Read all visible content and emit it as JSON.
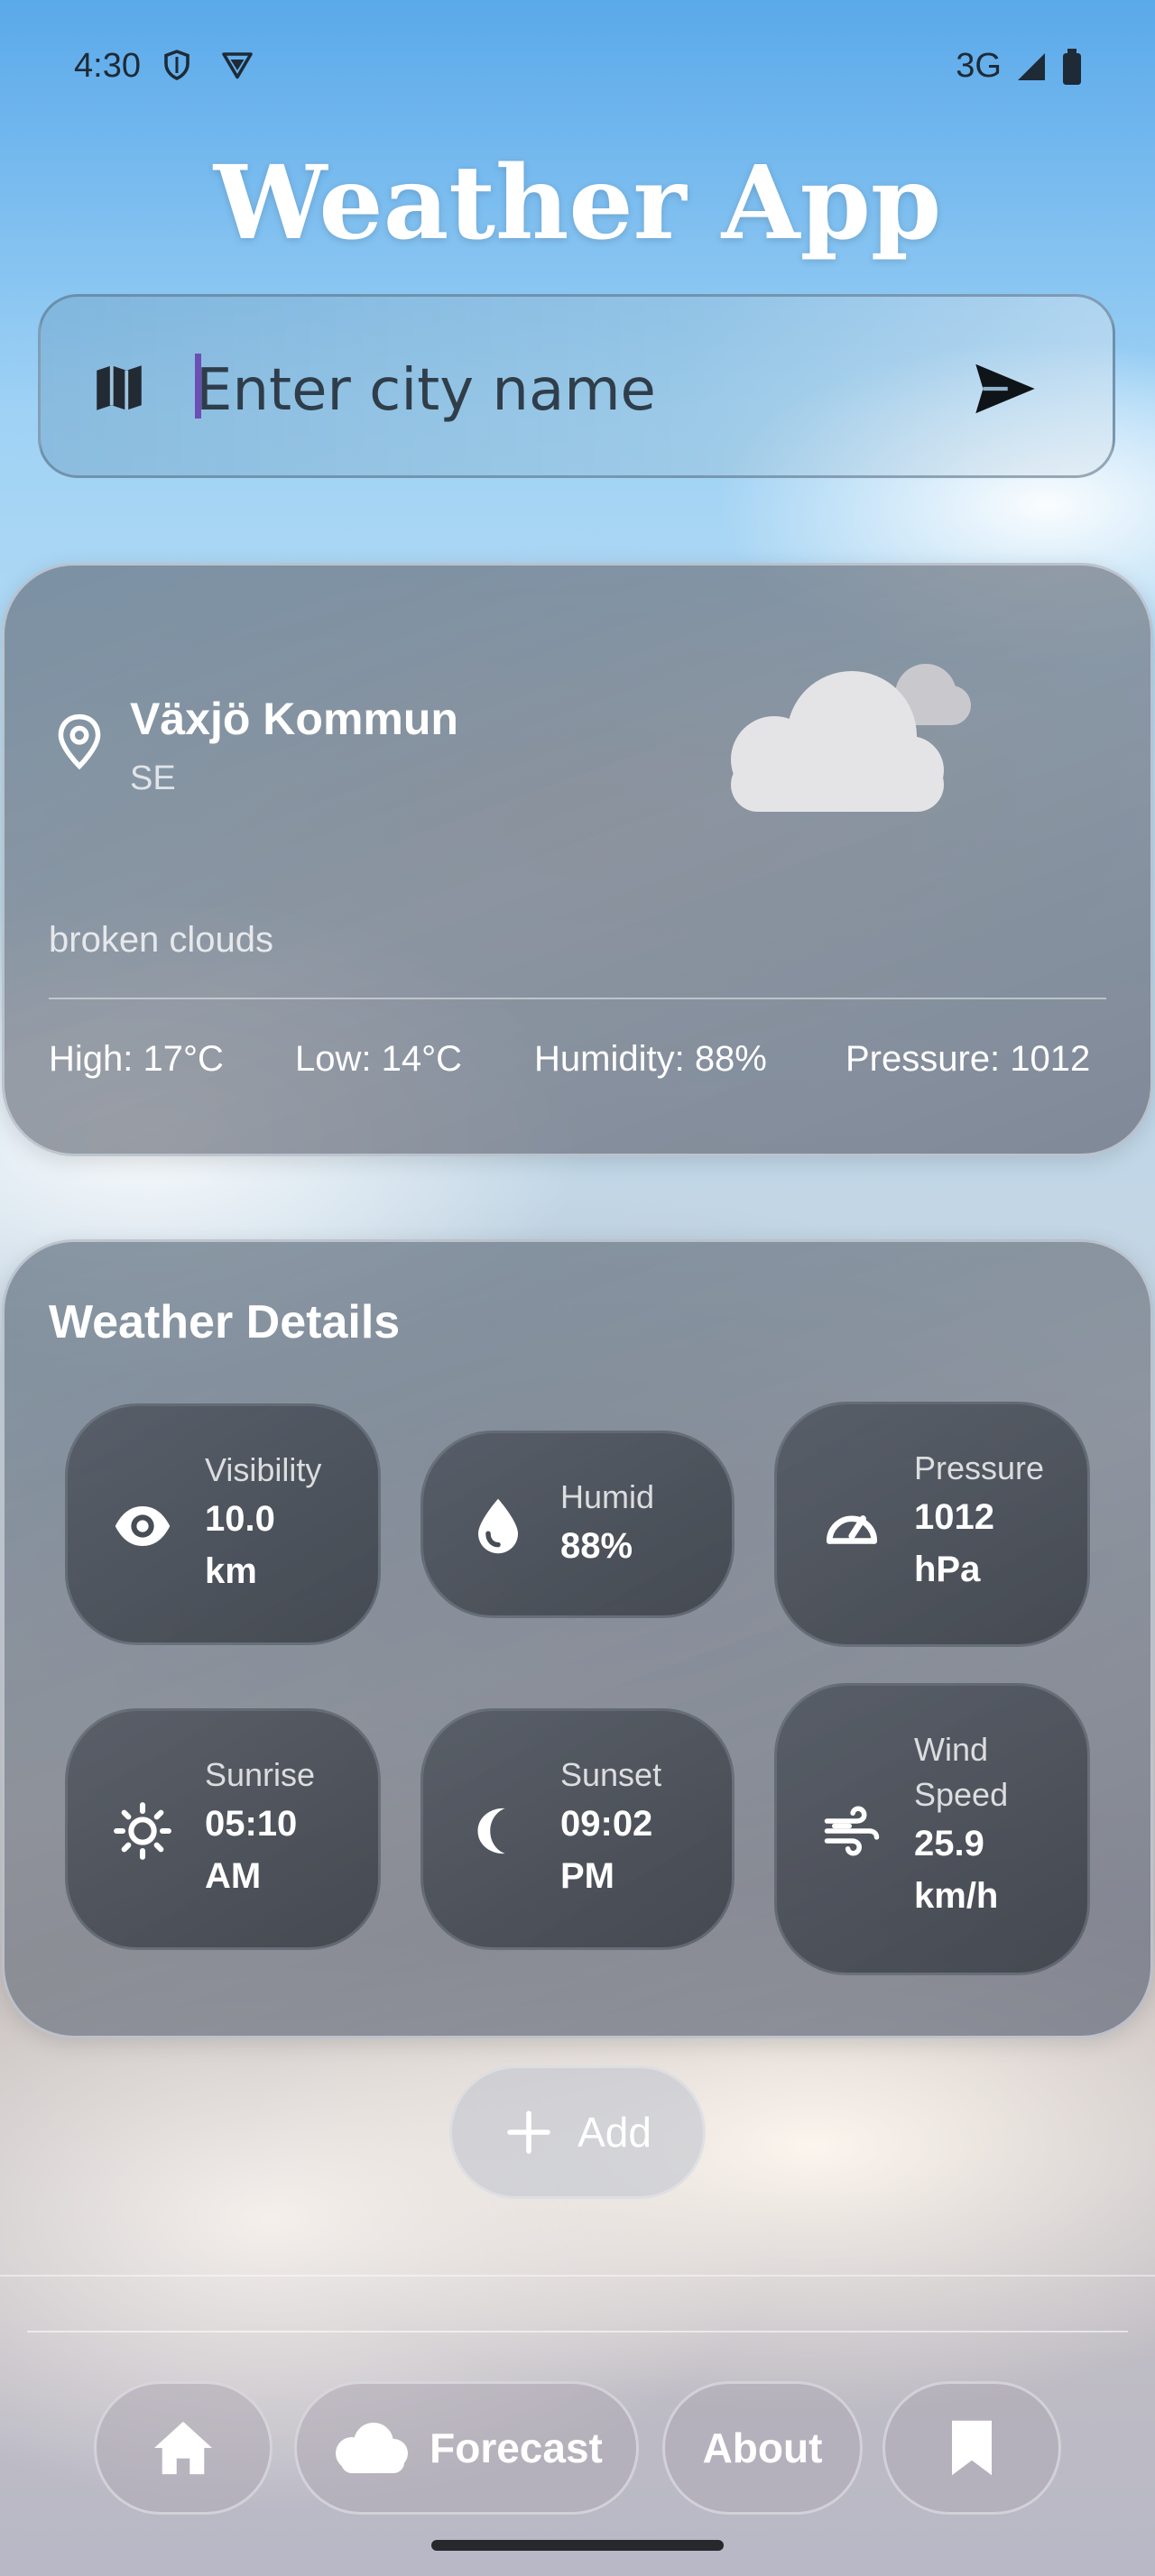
{
  "status_bar": {
    "time": "4:30",
    "network": "3G"
  },
  "app": {
    "title": "Weather App"
  },
  "search": {
    "placeholder": "Enter city name"
  },
  "current": {
    "city": "Växjö Kommun",
    "country": "SE",
    "description": "broken clouds",
    "high": "High: 17°C",
    "low": "Low: 14°C",
    "humidity": "Humidity: 88%",
    "pressure": "Pressure: 1012"
  },
  "details": {
    "title": "Weather Details",
    "items": [
      {
        "label": "Visibility",
        "value_line1": "10.0",
        "value_line2": "km",
        "icon": "eye-icon"
      },
      {
        "label": "Humid",
        "value_line1": "88%",
        "value_line2": "",
        "icon": "water-drop-icon"
      },
      {
        "label": "Pressure",
        "value_line1": "1012",
        "value_line2": "hPa",
        "icon": "speedometer-icon"
      },
      {
        "label": "Sunrise",
        "value_line1": "05:10",
        "value_line2": "AM",
        "icon": "sun-icon"
      },
      {
        "label": "Sunset",
        "value_line1": "09:02",
        "value_line2": "PM",
        "icon": "moon-icon"
      },
      {
        "label_line1": "Wind",
        "label_line2": "Speed",
        "value_line1": "25.9",
        "value_line2": "km/h",
        "icon": "wind-icon"
      }
    ]
  },
  "add_button": {
    "label": "Add"
  },
  "nav": {
    "forecast": "Forecast",
    "about": "About"
  },
  "colors": {
    "caret": "#6b4fb5",
    "card": "#7a8593",
    "tile": "#3a3f47"
  }
}
